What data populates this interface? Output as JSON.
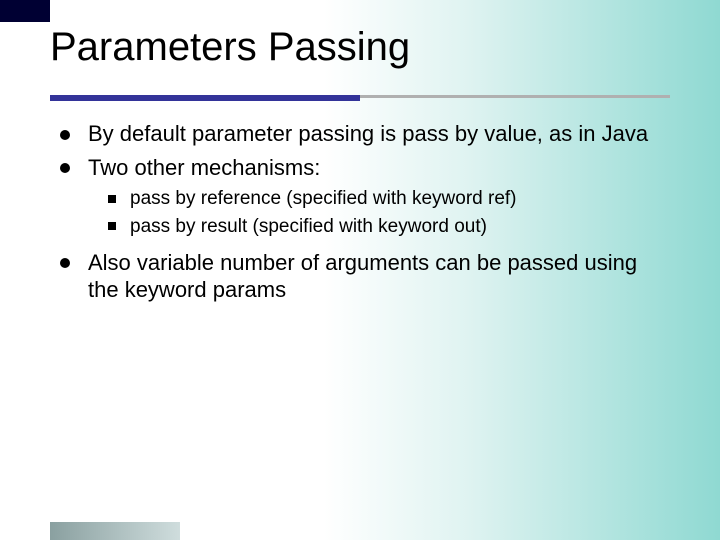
{
  "title": "Parameters Passing",
  "bullets": {
    "b1": "By default parameter passing is pass by value, as in Java",
    "b2": "Two other mechanisms:",
    "b2_sub": {
      "s1": "pass by reference (specified with keyword ref)",
      "s2": "pass by result (specified with keyword out)"
    },
    "b3": "Also variable number of arguments can be passed using the keyword params"
  }
}
